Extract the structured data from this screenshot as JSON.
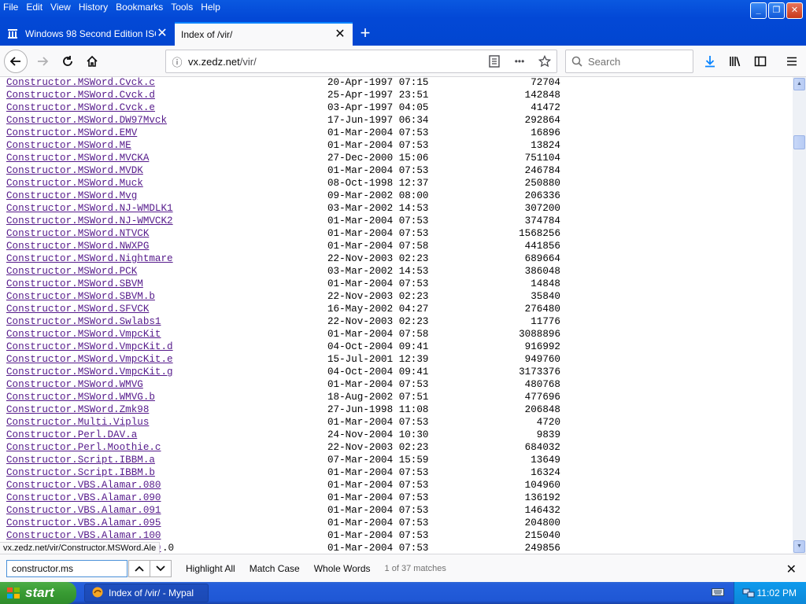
{
  "menu": [
    "File",
    "Edit",
    "View",
    "History",
    "Bookmarks",
    "Tools",
    "Help"
  ],
  "tabs": [
    {
      "title": "Windows 98 Second Edition ISO File",
      "active": false
    },
    {
      "title": "Index of /vir/",
      "active": true
    }
  ],
  "address": {
    "url_host": "vx.zedz.net",
    "url_path": "/vir/"
  },
  "search": {
    "placeholder": "Search"
  },
  "files": [
    {
      "name": "Constructor.MSWord.Cvck.c",
      "date": "20-Apr-1997 07:15",
      "size": "72704"
    },
    {
      "name": "Constructor.MSWord.Cvck.d",
      "date": "25-Apr-1997 23:51",
      "size": "142848"
    },
    {
      "name": "Constructor.MSWord.Cvck.e",
      "date": "03-Apr-1997 04:05",
      "size": "41472"
    },
    {
      "name": "Constructor.MSWord.DW97Mvck",
      "date": "17-Jun-1997 06:34",
      "size": "292864"
    },
    {
      "name": "Constructor.MSWord.EMV",
      "date": "01-Mar-2004 07:53",
      "size": "16896"
    },
    {
      "name": "Constructor.MSWord.ME",
      "date": "01-Mar-2004 07:53",
      "size": "13824"
    },
    {
      "name": "Constructor.MSWord.MVCKA",
      "date": "27-Dec-2000 15:06",
      "size": "751104"
    },
    {
      "name": "Constructor.MSWord.MVDK",
      "date": "01-Mar-2004 07:53",
      "size": "246784"
    },
    {
      "name": "Constructor.MSWord.Muck",
      "date": "08-Oct-1998 12:37",
      "size": "250880"
    },
    {
      "name": "Constructor.MSWord.Mvg",
      "date": "09-Mar-2002 08:00",
      "size": "206336"
    },
    {
      "name": "Constructor.MSWord.NJ-WMDLK1",
      "date": "03-Mar-2002 14:53",
      "size": "307200"
    },
    {
      "name": "Constructor.MSWord.NJ-WMVCK2",
      "date": "01-Mar-2004 07:53",
      "size": "374784"
    },
    {
      "name": "Constructor.MSWord.NTVCK",
      "date": "01-Mar-2004 07:53",
      "size": "1568256"
    },
    {
      "name": "Constructor.MSWord.NWXPG",
      "date": "01-Mar-2004 07:58",
      "size": "441856"
    },
    {
      "name": "Constructor.MSWord.Nightmare",
      "date": "22-Nov-2003 02:23",
      "size": "689664"
    },
    {
      "name": "Constructor.MSWord.PCK",
      "date": "03-Mar-2002 14:53",
      "size": "386048"
    },
    {
      "name": "Constructor.MSWord.SBVM",
      "date": "01-Mar-2004 07:53",
      "size": "14848"
    },
    {
      "name": "Constructor.MSWord.SBVM.b",
      "date": "22-Nov-2003 02:23",
      "size": "35840"
    },
    {
      "name": "Constructor.MSWord.SFVCK",
      "date": "16-May-2002 04:27",
      "size": "276480"
    },
    {
      "name": "Constructor.MSWord.Swlabs1",
      "date": "22-Nov-2003 02:23",
      "size": "11776"
    },
    {
      "name": "Constructor.MSWord.VmpcKit",
      "date": "01-Mar-2004 07:58",
      "size": "3088896"
    },
    {
      "name": "Constructor.MSWord.VmpcKit.d",
      "date": "04-Oct-2004 09:41",
      "size": "916992"
    },
    {
      "name": "Constructor.MSWord.VmpcKit.e",
      "date": "15-Jul-2001 12:39",
      "size": "949760"
    },
    {
      "name": "Constructor.MSWord.VmpcKit.g",
      "date": "04-Oct-2004 09:41",
      "size": "3173376"
    },
    {
      "name": "Constructor.MSWord.WMVG",
      "date": "01-Mar-2004 07:53",
      "size": "480768"
    },
    {
      "name": "Constructor.MSWord.WMVG.b",
      "date": "18-Aug-2002 07:51",
      "size": "477696"
    },
    {
      "name": "Constructor.MSWord.Zmk98",
      "date": "27-Jun-1998 11:08",
      "size": "206848"
    },
    {
      "name": "Constructor.Multi.Viplus",
      "date": "01-Mar-2004 07:53",
      "size": "4720"
    },
    {
      "name": "Constructor.Perl.DAV.a",
      "date": "24-Nov-2004 10:30",
      "size": "9839"
    },
    {
      "name": "Constructor.Perl.Moothie.c",
      "date": "22-Nov-2003 02:23",
      "size": "684032"
    },
    {
      "name": "Constructor.Script.IBBM.a",
      "date": "07-Mar-2004 15:59",
      "size": "13649"
    },
    {
      "name": "Constructor.Script.IBBM.b",
      "date": "01-Mar-2004 07:53",
      "size": "16324"
    },
    {
      "name": "Constructor.VBS.Alamar.080",
      "date": "01-Mar-2004 07:53",
      "size": "104960"
    },
    {
      "name": "Constructor.VBS.Alamar.090",
      "date": "01-Mar-2004 07:53",
      "size": "136192"
    },
    {
      "name": "Constructor.VBS.Alamar.091",
      "date": "01-Mar-2004 07:53",
      "size": "146432"
    },
    {
      "name": "Constructor.VBS.Alamar.095",
      "date": "01-Mar-2004 07:53",
      "size": "204800"
    },
    {
      "name": "Constructor.VBS.Alamar.100",
      "date": "01-Mar-2004 07:53",
      "size": "215040"
    },
    {
      "name": "Constructor.VBS.Alamar.100",
      "date": "01-Mar-2004 07:53",
      "size": "249856"
    }
  ],
  "status_link": "vx.zedz.net/vir/Constructor.MSWord.Ale",
  "status_suffix": ".0",
  "findbar": {
    "query": "constructor.ms",
    "highlight_all": "Highlight All",
    "match_case": "Match Case",
    "whole_words": "Whole Words",
    "matches": "1 of 37 matches"
  },
  "taskbar": {
    "start_label": "start",
    "task_label": "Index of /vir/ - Mypal",
    "clock": "11:02 PM"
  },
  "colors": {
    "link": "#551a8b",
    "titlebar": "#0348d6",
    "start_green": "#389b33"
  }
}
